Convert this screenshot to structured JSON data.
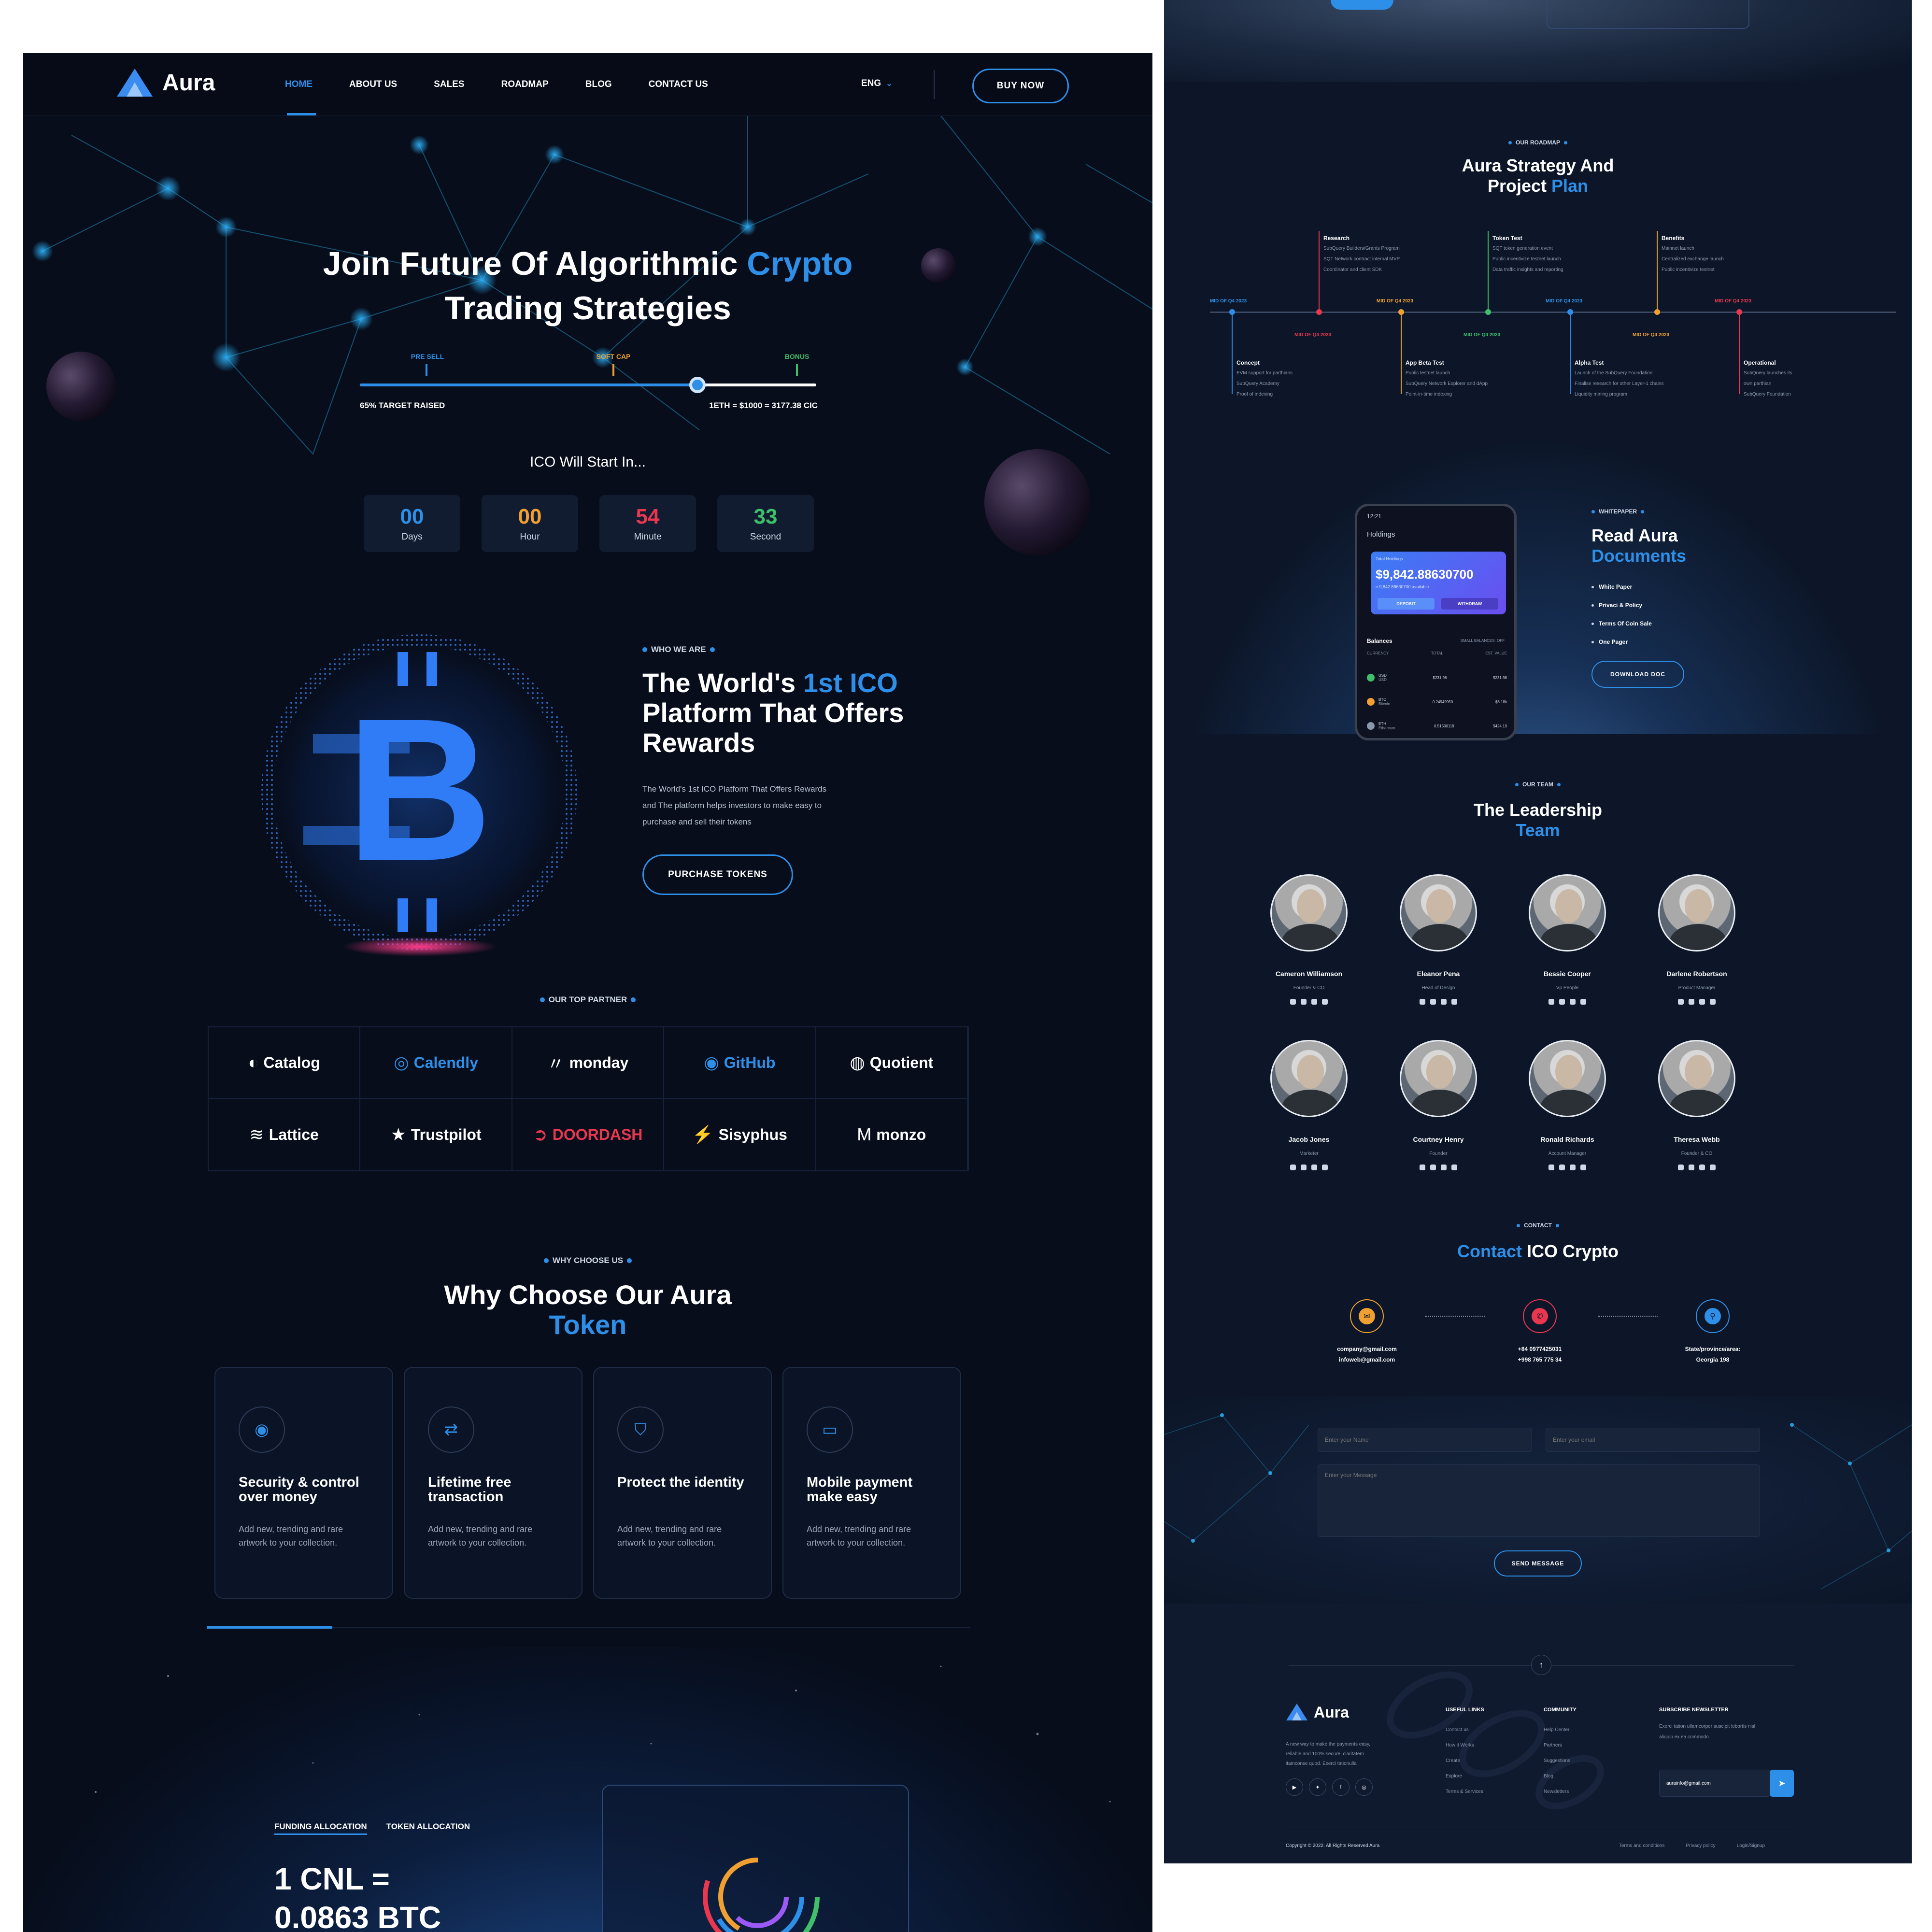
{
  "nav": {
    "brand": "Aura",
    "links": [
      "HOME",
      "ABOUT US",
      "SALES",
      "ROADMAP",
      "BLOG",
      "CONTACT US"
    ],
    "lang": "ENG",
    "buy": "BUY NOW"
  },
  "hero": {
    "title_a": "Join Future Of Algorithmic ",
    "title_hl": "Crypto",
    "title_b": "Trading Strategies",
    "markers": [
      "PRE SELL",
      "SOFT CAP",
      "BONUS"
    ],
    "raised": "65% TARGET RAISED",
    "rate": "1ETH = $1000 = 3177.38 CIC",
    "progress": 0.74,
    "ico_label": "ICO Will Start In...",
    "countdown": [
      {
        "value": "00",
        "label": "Days",
        "color": "#2e8fe8"
      },
      {
        "value": "00",
        "label": "Hour",
        "color": "#f0a030"
      },
      {
        "value": "54",
        "label": "Minute",
        "color": "#e8374f"
      },
      {
        "value": "33",
        "label": "Second",
        "color": "#3fbf6a"
      }
    ]
  },
  "about": {
    "eyebrow": "WHO WE ARE",
    "title_a": "The World's ",
    "title_hl": "1st ICO",
    "title_b": "Platform That Offers",
    "title_c": "Rewards",
    "desc1": "The World's 1st ICO Platform That Offers Rewards",
    "desc2": "and The platform helps investors to make easy to",
    "desc3": "purchase and sell their tokens",
    "cta": "PURCHASE TOKENS"
  },
  "partners": {
    "eyebrow": "OUR TOP PARTNER",
    "items": [
      {
        "name": "Catalog",
        "color": "#ffffff"
      },
      {
        "name": "Calendly",
        "color": "#2e8fe8"
      },
      {
        "name": "monday",
        "color": "#ffffff"
      },
      {
        "name": "GitHub",
        "color": "#2e8fe8"
      },
      {
        "name": "Quotient",
        "color": "#ffffff"
      },
      {
        "name": "Lattice",
        "color": "#ffffff"
      },
      {
        "name": "Trustpilot",
        "color": "#ffffff"
      },
      {
        "name": "DOORDASH",
        "color": "#e8374f"
      },
      {
        "name": "Sisyphus",
        "color": "#ffffff"
      },
      {
        "name": "monzo",
        "color": "#ffffff"
      }
    ]
  },
  "why": {
    "eyebrow": "WHY CHOOSE US",
    "title_a": "Why Choose Our Aura",
    "title_hl": "Token",
    "cards": [
      {
        "t1": "Security & control",
        "t2": "over money",
        "icon": "fingerprint-icon",
        "d1": "Add new, trending and rare",
        "d2": "artwork to your collection."
      },
      {
        "t1": "Lifetime free",
        "t2": "transaction",
        "icon": "swap-icon",
        "d1": "Add new, trending and rare",
        "d2": "artwork to your collection."
      },
      {
        "t1": "Protect the identity",
        "t2": "",
        "icon": "shield-icon",
        "d1": "Add new, trending and rare",
        "d2": "artwork to your collection."
      },
      {
        "t1": "Mobile payment",
        "t2": "make easy",
        "icon": "wallet-icon",
        "d1": "Add new, trending and rare",
        "d2": "artwork to your collection."
      }
    ]
  },
  "token": {
    "tab1": "FUNDING ALLOCATION",
    "tab2": "TOKEN ALLOCATION",
    "price1": "1 CNL =",
    "price2": "0.0863 BTC"
  },
  "roadmap": {
    "eyebrow": "OUR ROADMAP",
    "title_a": "Aura Strategy And",
    "title_b": "Project ",
    "title_hl": "Plan",
    "top": [
      {
        "title": "Research",
        "lines": [
          "SubQuery Builders/Grants Program",
          "SQT Network contract internal MVP",
          "Coordinator and client SDK"
        ],
        "color": "#e8374f"
      },
      {
        "title": "Token Test",
        "lines": [
          "SQT token generation event",
          "Public incentivize testnet launch",
          "Data traffic insights and reporting"
        ],
        "color": "#3fbf6a"
      },
      {
        "title": "Benefits",
        "lines": [
          "Mainnet launch",
          "Centralized exchange launch",
          "Public incentivize testnet"
        ],
        "color": "#f0a030"
      }
    ],
    "top_dates": [
      "MID OF Q4 2023",
      "MID OF Q4 2023",
      "MID OF Q4 2023",
      "MID OF Q4 2023"
    ],
    "bottom_dates": [
      "MID OF Q4 2023",
      "MID OF Q4 2023",
      "MID OF Q4 2023"
    ],
    "bottom": [
      {
        "title": "Concept",
        "lines": [
          "EVM support for parthians",
          "SubQuery Academy",
          "Proof of indexing"
        ],
        "color": "#2e8fe8"
      },
      {
        "title": "App Beta Test",
        "lines": [
          "Public testnet launch",
          "SubQuery Network Explorer and dApp",
          "Point-in-time indexing"
        ],
        "color": "#f0a030"
      },
      {
        "title": "Alpha Test",
        "lines": [
          "Launch of the SubQuery Foundation",
          "Finalise research for other Layer-1 chains",
          "Liquidity mining program"
        ],
        "color": "#2e8fe8"
      },
      {
        "title": "Operational",
        "lines": [
          "SubQuery launches its",
          "own parthian",
          "SubQuery Foundation"
        ],
        "color": "#e8374f"
      }
    ]
  },
  "docs": {
    "eyebrow": "WHITEPAPER",
    "title_a": "Read Aura",
    "title_hl": "Documents",
    "items": [
      "White Paper",
      "Privaci & Policy",
      "Terms Of Coin Sale",
      "One Pager"
    ],
    "cta": "DOWNLOAD DOC",
    "phone": {
      "time": "12:21",
      "holdings": "Holdings",
      "balance_label": "Total Holdings",
      "balance": "$9,842.88630700",
      "available": "≈ 9,842.88630700 available",
      "deposit": "DEPOSIT",
      "withdraw": "WITHDRAW",
      "balances": "Balances",
      "small": "SMALL BALANCES: OFF",
      "col_currency": "CURRENCY",
      "col_total": "TOTAL",
      "col_est": "EST. VALUE",
      "rows": [
        {
          "sym": "USD",
          "name": "USD",
          "total": "$231.98",
          "est": "$231.98",
          "color": "#3fbf6a"
        },
        {
          "sym": "BTC",
          "name": "Bitcoin",
          "total": "0.24949950",
          "est": "$6.18k",
          "color": "#f0a030"
        },
        {
          "sym": "ETH",
          "name": "Ethereum",
          "total": "0.51500119",
          "est": "$424.19",
          "color": "#8a97ad"
        }
      ]
    }
  },
  "team": {
    "eyebrow": "OUR TEAM",
    "title_a": "The Leadership",
    "title_hl": "Team",
    "members": [
      {
        "name": "Cameron Williamson",
        "role": "Founder & CO"
      },
      {
        "name": "Eleanor Pena",
        "role": "Head of Design"
      },
      {
        "name": "Bessie Cooper",
        "role": "Vp People"
      },
      {
        "name": "Darlene Robertson",
        "role": "Product Manager"
      },
      {
        "name": "Jacob Jones",
        "role": "Marketer"
      },
      {
        "name": "Courtney Henry",
        "role": "Founder"
      },
      {
        "name": "Ronald Richards",
        "role": "Account Manager"
      },
      {
        "name": "Theresa Webb",
        "role": "Founder & CO"
      }
    ]
  },
  "contact": {
    "eyebrow": "CONTACT",
    "title_hl": "Contact",
    "title_b": " ICO Crypto",
    "items": [
      {
        "l1": "company@gmail.com",
        "l2": "infoweb@gmail.com",
        "color": "#f0a030"
      },
      {
        "l1": "+84 0977425031",
        "l2": "+998 765 775 34",
        "color": "#e8374f"
      },
      {
        "l1": "State/province/area:",
        "l2": "Georgia 198",
        "color": "#2e8fe8"
      }
    ],
    "name_ph": "Enter your Name",
    "email_ph": "Enter your email",
    "msg_ph": "Enter your Message",
    "send": "SEND MESSAGE"
  },
  "footer": {
    "brand": "Aura",
    "about1": "A new way to make the payments easy,",
    "about2": "reliable and 100% secure. claritatem",
    "about3": "itamconse quod. Exerci tationulla",
    "useful_title": "USEFUL LINKS",
    "useful": [
      "Contact us",
      "How it Works",
      "Create",
      "Explore",
      "Terms & Services"
    ],
    "community_title": "COMMUNITY",
    "community": [
      "Help Center",
      "Partners",
      "Suggestions",
      "Blog",
      "Newsletters"
    ],
    "news_title": "SUBSCRIBE NEWSLETTER",
    "news1": "Exerci tation ullamcorper suscipit lobortis nisl",
    "news2": "aliquip ex ea commodo",
    "email_value": "aurainfo@gmail.com",
    "copyright": "Copyright © 2022. All Rights Reserved Aura",
    "bottom_links": [
      "Terms and conditions",
      "Privacy policy",
      "Login/Signup"
    ]
  }
}
